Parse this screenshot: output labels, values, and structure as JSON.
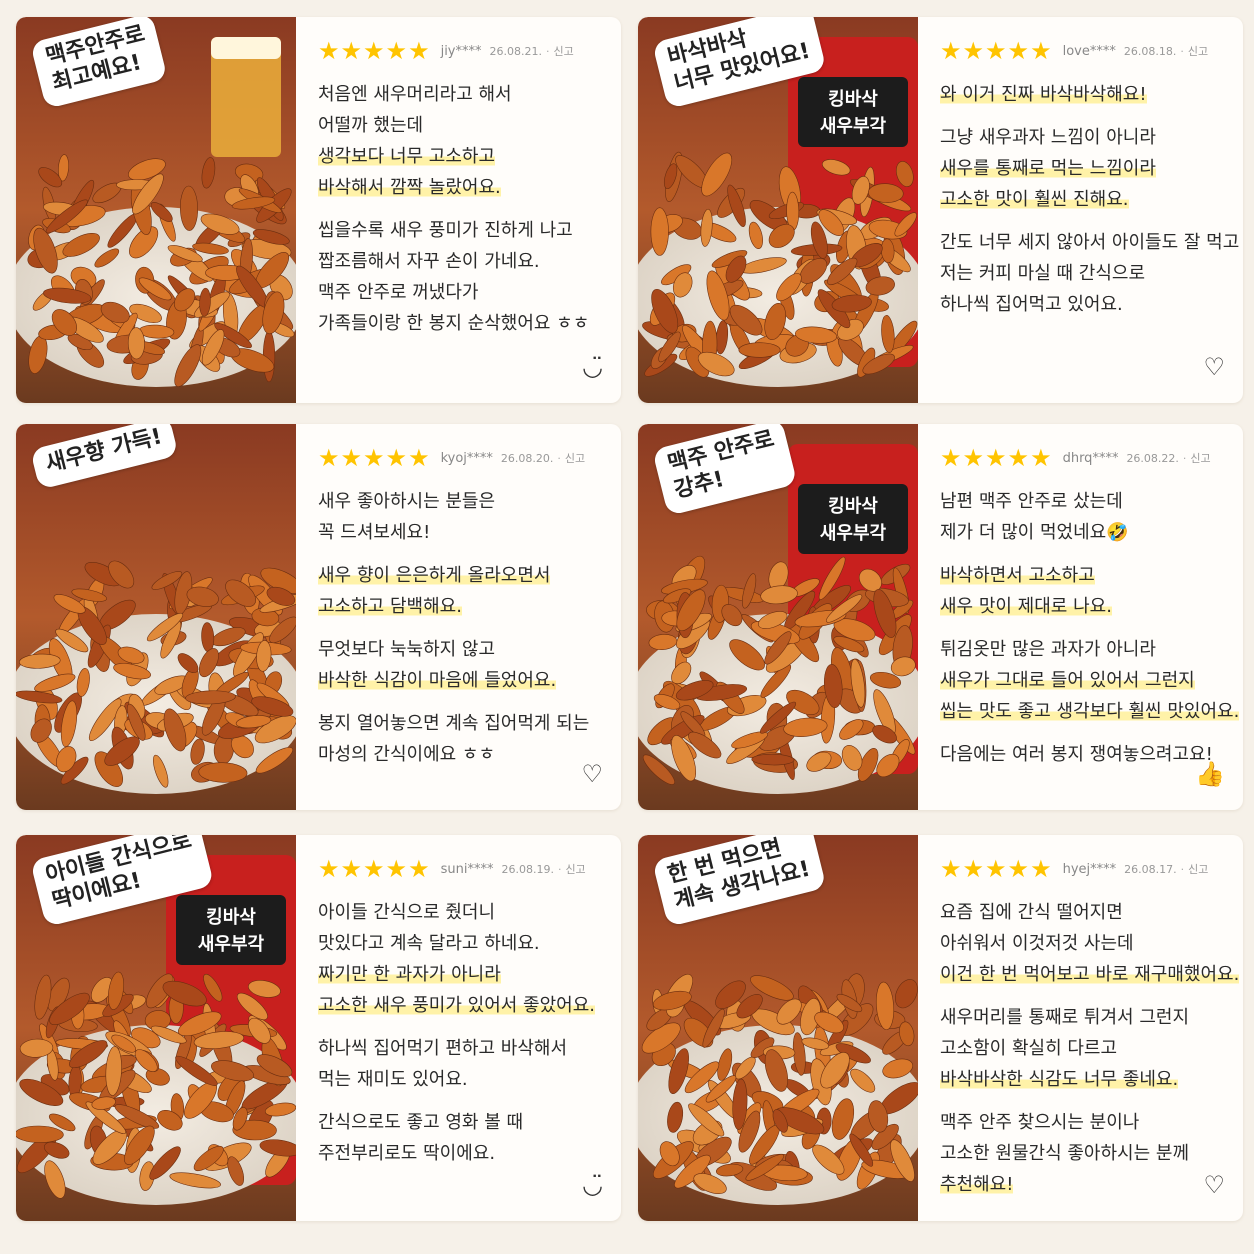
{
  "reviews": [
    {
      "stars": 5,
      "user": "jiy****",
      "date": "26.08.21.",
      "report": "신고",
      "caption": "맥주안주로\n최고예요!",
      "doodle": "◡̈",
      "paragraphs": [
        [
          {
            "text": "처음엔 새우머리라고 해서",
            "hl": false
          },
          {
            "text": "어떨까 했는데",
            "hl": false
          },
          {
            "text": "생각보다 너무 고소하고",
            "hl": true
          },
          {
            "text": "바삭해서 깜짝 놀랐어요.",
            "hl": true
          }
        ],
        [
          {
            "text": "씹을수록 새우 풍미가 진하게 나고",
            "hl": false
          },
          {
            "text": "짭조름해서 자꾸 손이 가네요.",
            "hl": false
          },
          {
            "text": "맥주 안주로 꺼냈다가",
            "hl": false
          },
          {
            "text": "가족들이랑 한 봉지 순삭했어요 ㅎㅎ",
            "hl": false
          }
        ]
      ]
    },
    {
      "stars": 5,
      "user": "love****",
      "date": "26.08.18.",
      "report": "신고",
      "caption": "바삭바삭\n너무 맛있어요!",
      "doodle": "♡",
      "paragraphs": [
        [
          {
            "text": "와 이거 진짜 바삭바삭해요!",
            "hl": true
          }
        ],
        [
          {
            "text": "그냥 새우과자 느낌이 아니라",
            "hl": false
          },
          {
            "text": "새우를 통째로 먹는 느낌이라",
            "hl": true
          },
          {
            "text": "고소한 맛이 훨씬 진해요.",
            "hl": true
          }
        ],
        [
          {
            "text": "간도 너무 세지 않아서 아이들도 잘 먹고",
            "hl": false
          },
          {
            "text": "저는 커피 마실 때 간식으로",
            "hl": false
          },
          {
            "text": "하나씩 집어먹고 있어요.",
            "hl": false
          }
        ]
      ]
    },
    {
      "stars": 5,
      "user": "kyoj****",
      "date": "26.08.20.",
      "report": "신고",
      "caption": "새우향 가득!",
      "doodle": "♡",
      "paragraphs": [
        [
          {
            "text": "새우 좋아하시는 분들은",
            "hl": false
          },
          {
            "text": "꼭 드셔보세요!",
            "hl": false
          }
        ],
        [
          {
            "text": "새우 향이 은은하게 올라오면서",
            "hl": true
          },
          {
            "text": "고소하고 담백해요.",
            "hl": true
          }
        ],
        [
          {
            "text": "무엇보다 눅눅하지 않고",
            "hl": false
          },
          {
            "text": "바삭한 식감이 마음에 들었어요.",
            "hl": true
          }
        ],
        [
          {
            "text": "봉지 열어놓으면 계속 집어먹게 되는",
            "hl": false
          },
          {
            "text": "마성의 간식이에요 ㅎㅎ",
            "hl": false
          }
        ]
      ]
    },
    {
      "stars": 5,
      "user": "dhrq****",
      "date": "26.08.22.",
      "report": "신고",
      "caption": "맥주 안주로\n강추!",
      "doodle": "👍",
      "paragraphs": [
        [
          {
            "text": "남편 맥주 안주로 샀는데",
            "hl": false
          },
          {
            "text": "제가 더 많이 먹었네요🤣",
            "hl": false
          }
        ],
        [
          {
            "text": "바삭하면서 고소하고",
            "hl": true
          },
          {
            "text": "새우 맛이 제대로 나요.",
            "hl": true
          }
        ],
        [
          {
            "text": "튀김옷만 많은 과자가 아니라",
            "hl": false
          },
          {
            "text": "새우가 그대로 들어 있어서 그런지",
            "hl": true
          },
          {
            "text": "씹는 맛도 좋고 생각보다 훨씬 맛있어요.",
            "hl": true
          }
        ],
        [
          {
            "text": "다음에는 여러 봉지 쟁여놓으려고요!",
            "hl": false
          }
        ]
      ]
    },
    {
      "stars": 5,
      "user": "suni****",
      "date": "26.08.19.",
      "report": "신고",
      "caption": "아이들 간식으로\n딱이에요!",
      "doodle": "◡̈",
      "paragraphs": [
        [
          {
            "text": "아이들 간식으로 줬더니",
            "hl": false
          },
          {
            "text": "맛있다고 계속 달라고 하네요.",
            "hl": false
          },
          {
            "text": "짜기만 한 과자가 아니라",
            "hl": true
          },
          {
            "text": "고소한 새우 풍미가 있어서 좋았어요.",
            "hl": true
          }
        ],
        [
          {
            "text": "하나씩 집어먹기 편하고 바삭해서",
            "hl": false
          },
          {
            "text": "먹는 재미도 있어요.",
            "hl": false
          }
        ],
        [
          {
            "text": "간식으로도 좋고 영화 볼 때",
            "hl": false
          },
          {
            "text": "주전부리로도 딱이에요.",
            "hl": false
          }
        ]
      ]
    },
    {
      "stars": 5,
      "user": "hyej****",
      "date": "26.08.17.",
      "report": "신고",
      "caption": "한 번 먹으면\n계속 생각나요!",
      "doodle": "♡",
      "paragraphs": [
        [
          {
            "text": "요즘 집에 간식 떨어지면",
            "hl": false
          },
          {
            "text": "아쉬워서 이것저것 사는데",
            "hl": false
          },
          {
            "text": "이건 한 번 먹어보고 바로 재구매했어요.",
            "hl": true
          }
        ],
        [
          {
            "text": "새우머리를 통째로 튀겨서 그런지",
            "hl": false
          },
          {
            "text": "고소함이 확실히 다르고",
            "hl": false
          },
          {
            "text": "바삭바삭한 식감도 너무 좋네요.",
            "hl": true
          }
        ],
        [
          {
            "text": "맥주 안주 찾으시는 분이나",
            "hl": false
          },
          {
            "text": "고소한 원물간식 좋아하시는 분께",
            "hl": false
          },
          {
            "text": "추천해요!",
            "hl": true
          }
        ]
      ]
    }
  ]
}
